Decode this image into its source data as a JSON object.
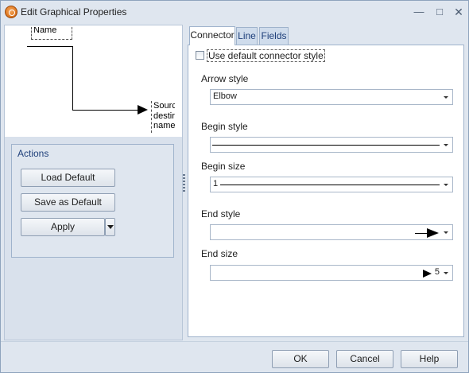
{
  "window": {
    "title": "Edit Graphical Properties",
    "minimize": "—",
    "maximize": "□",
    "close": "✕"
  },
  "preview": {
    "source_label": "Name",
    "destination_label": "Sourc\ndestir\nname"
  },
  "actions": {
    "title": "Actions",
    "load_default": "Load Default",
    "save_as_default": "Save as Default",
    "apply": "Apply"
  },
  "tabs": [
    {
      "label": "Connector",
      "active": true
    },
    {
      "label": "Line",
      "active": false
    },
    {
      "label": "Fields",
      "active": false
    }
  ],
  "connector": {
    "use_default_label": "Use default connector style",
    "use_default_checked": false,
    "arrow_style_label": "Arrow style",
    "arrow_style_value": "Elbow",
    "begin_style_label": "Begin style",
    "begin_size_label": "Begin size",
    "begin_size_value": "1",
    "end_style_label": "End style",
    "end_size_label": "End size",
    "end_size_value": "5"
  },
  "footer": {
    "ok": "OK",
    "cancel": "Cancel",
    "help": "Help"
  },
  "colors": {
    "window_bg": "#dfe6ef",
    "accent_text": "#1e3f7a",
    "border": "#9fb3cc"
  }
}
